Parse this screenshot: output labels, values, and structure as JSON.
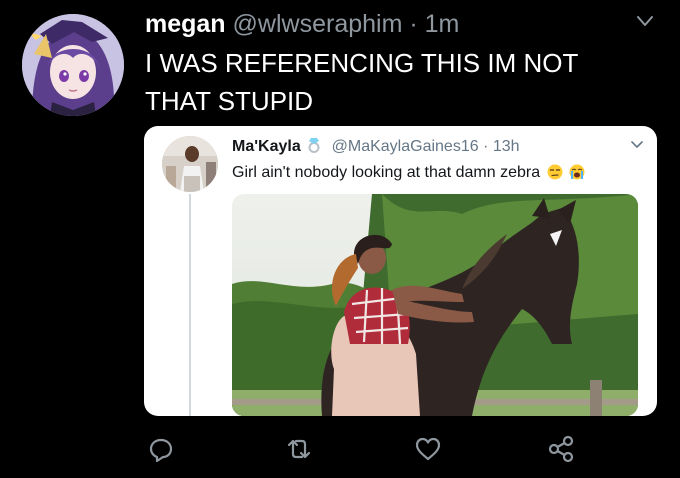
{
  "tweet": {
    "name": "megan",
    "handle": "@wlwseraphim",
    "separator": "·",
    "time": "1m",
    "text": "I WAS REFERENCING THIS IM NOT THAT STUPID",
    "avatar_icon": "anime-character-avatar",
    "more_icon": "chevron-down-icon"
  },
  "quoted_tweet": {
    "name": "Ma'Kayla",
    "badge_icon": "ring-emoji-icon",
    "handle": "@MaKaylaGaines16",
    "separator": "·",
    "time": "13h",
    "text": "Girl ain't nobody looking at that damn zebra",
    "emojis": [
      "unamused-face-emoji",
      "loudly-crying-face-emoji"
    ],
    "media": "photo-woman-petting-horse"
  },
  "actions": [
    {
      "name": "reply-icon"
    },
    {
      "name": "retweet-icon"
    },
    {
      "name": "like-icon"
    },
    {
      "name": "share-icon"
    }
  ],
  "colors": {
    "background": "#000000",
    "text": "#ffffff",
    "secondary_text": "#8f979f",
    "card_background": "#ffffff",
    "card_text": "#14171a",
    "card_secondary": "#657786"
  }
}
